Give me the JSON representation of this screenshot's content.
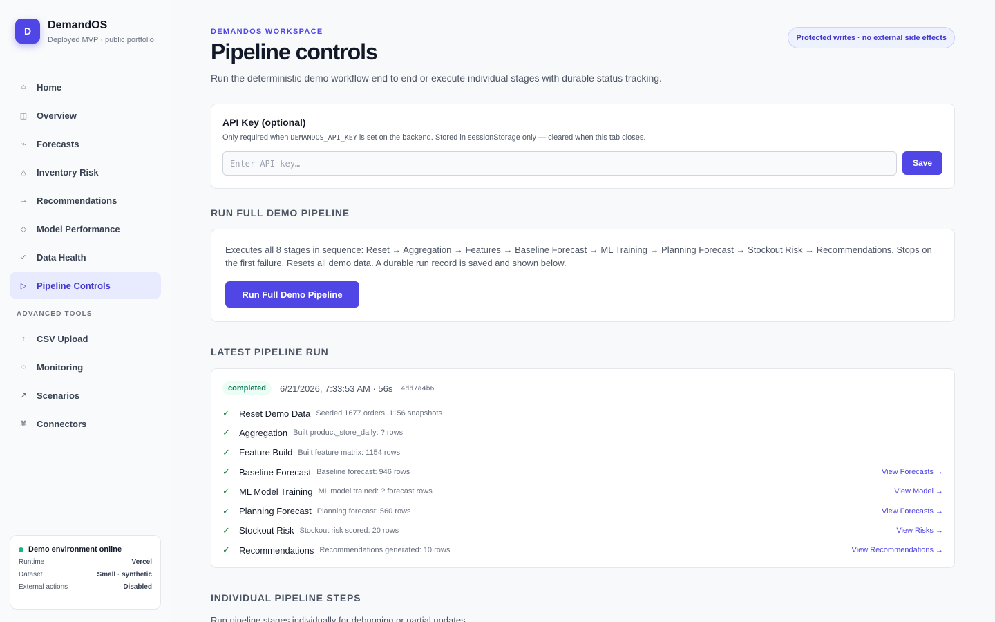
{
  "brand": {
    "logo": "D",
    "name": "DemandOS",
    "subtitle": "Deployed MVP · public portfolio"
  },
  "nav": {
    "items": [
      {
        "label": "Home",
        "icon": "⌂",
        "icon_name": "home-icon"
      },
      {
        "label": "Overview",
        "icon": "◫",
        "icon_name": "overview-icon"
      },
      {
        "label": "Forecasts",
        "icon": "⌁",
        "icon_name": "forecast-icon"
      },
      {
        "label": "Inventory Risk",
        "icon": "△",
        "icon_name": "warning-icon"
      },
      {
        "label": "Recommendations",
        "icon": "→",
        "icon_name": "arrow-right-icon"
      },
      {
        "label": "Model Performance",
        "icon": "◇",
        "icon_name": "diamond-icon"
      },
      {
        "label": "Data Health",
        "icon": "✓",
        "icon_name": "check-icon"
      },
      {
        "label": "Pipeline Controls",
        "icon": "▷",
        "icon_name": "play-icon",
        "active": true
      }
    ],
    "advanced_title": "ADVANCED TOOLS",
    "advanced_items": [
      {
        "label": "CSV Upload",
        "icon": "↑",
        "icon_name": "upload-icon"
      },
      {
        "label": "Monitoring",
        "icon": "◌",
        "icon_name": "monitor-icon"
      },
      {
        "label": "Scenarios",
        "icon": "↗",
        "icon_name": "scenario-icon"
      },
      {
        "label": "Connectors",
        "icon": "⌘",
        "icon_name": "connector-icon"
      }
    ]
  },
  "env_status": {
    "title": "Demo environment online",
    "rows": [
      {
        "label": "Runtime",
        "value": "Vercel"
      },
      {
        "label": "Dataset",
        "value": "Small · synthetic"
      },
      {
        "label": "External actions",
        "value": "Disabled"
      }
    ]
  },
  "header": {
    "eyebrow": "DEMANDOS WORKSPACE",
    "title": "Pipeline controls",
    "description": "Run the deterministic demo workflow end to end or execute individual stages with durable status tracking.",
    "badge": "Protected writes · no external side effects"
  },
  "api_key": {
    "title": "API Key (optional)",
    "help_pre": "Only required when ",
    "help_code": "DEMANDOS_API_KEY",
    "help_post": " is set on the backend. Stored in sessionStorage only — cleared when this tab closes.",
    "placeholder": "Enter API key…",
    "save_label": "Save"
  },
  "full_pipeline": {
    "section_title": "RUN FULL DEMO PIPELINE",
    "description": "Executes all 8 stages in sequence: Reset → Aggregation → Features → Baseline Forecast → ML Training → Planning Forecast → Stockout Risk → Recommendations. Stops on the first failure. Resets all demo data. A durable run record is saved and shown below.",
    "button_label": "Run Full Demo Pipeline"
  },
  "latest_run": {
    "section_title": "LATEST PIPELINE RUN",
    "status": "completed",
    "timestamp": "6/21/2026, 7:33:53 AM · 56s",
    "run_id": "4dd7a4b6",
    "steps": [
      {
        "name": "Reset Demo Data",
        "detail": "Seeded 1677 orders, 1156 snapshots",
        "link": ""
      },
      {
        "name": "Aggregation",
        "detail": "Built product_store_daily: ? rows",
        "link": ""
      },
      {
        "name": "Feature Build",
        "detail": "Built feature matrix: 1154 rows",
        "link": ""
      },
      {
        "name": "Baseline Forecast",
        "detail": "Baseline forecast: 946 rows",
        "link": "View Forecasts →"
      },
      {
        "name": "ML Model Training",
        "detail": "ML model trained: ? forecast rows",
        "link": "View Model →"
      },
      {
        "name": "Planning Forecast",
        "detail": "Planning forecast: 560 rows",
        "link": "View Forecasts →"
      },
      {
        "name": "Stockout Risk",
        "detail": "Stockout risk scored: 20 rows",
        "link": "View Risks →"
      },
      {
        "name": "Recommendations",
        "detail": "Recommendations generated: 10 rows",
        "link": "View Recommendations →"
      }
    ]
  },
  "individual": {
    "section_title": "INDIVIDUAL PIPELINE STEPS",
    "description": "Run pipeline stages individually for debugging or partial updates."
  },
  "colors": {
    "accent": "#4f46e5",
    "success": "#15803d",
    "online": "#10b981"
  }
}
